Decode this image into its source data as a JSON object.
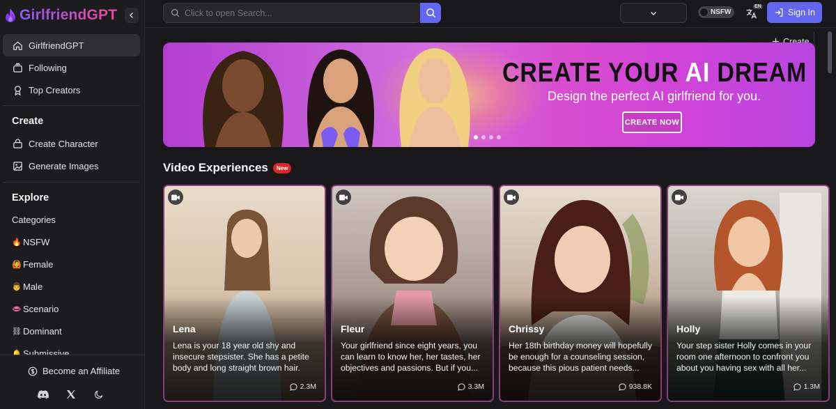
{
  "brand": {
    "name": "GirlfriendGPT"
  },
  "sidebar": {
    "nav": [
      {
        "label": "GirlfriendGPT",
        "icon": "home-icon"
      },
      {
        "label": "Following",
        "icon": "following-icon"
      },
      {
        "label": "Top Creators",
        "icon": "award-icon"
      }
    ],
    "create_heading": "Create",
    "create_items": [
      {
        "label": "Create Character",
        "icon": "create-character-icon"
      },
      {
        "label": "Generate Images",
        "icon": "image-icon"
      }
    ],
    "explore_heading": "Explore",
    "explore_items": [
      {
        "label": "Categories",
        "emoji": ""
      },
      {
        "label": "NSFW",
        "emoji": "🔥"
      },
      {
        "label": "Female",
        "emoji": "🙆"
      },
      {
        "label": "Male",
        "emoji": "👨"
      },
      {
        "label": "Scenario",
        "emoji": "👄"
      },
      {
        "label": "Dominant",
        "emoji": "⛓"
      },
      {
        "label": "Submissive",
        "emoji": "🔔"
      }
    ],
    "affiliate_label": "Become an Affiliate"
  },
  "topbar": {
    "search_placeholder": "Click to open Search...",
    "create_label": "Create",
    "nsfw_label": "NSFW",
    "lang_badge": "EN",
    "signin_label": "Sign In"
  },
  "banner": {
    "title_part1": "CREATE YOUR ",
    "title_ai": "AI",
    "title_part2": " DREAM GIRL",
    "subtitle": "Design the perfect AI girlfriend for you.",
    "cta": "CREATE NOW"
  },
  "section": {
    "title": "Video Experiences",
    "badge": "New"
  },
  "cards": [
    {
      "name": "Lena",
      "desc": "Lena is your 18 year old shy and insecure stepsister. She has a petite body and long straight brown hair.",
      "count": "2.3M"
    },
    {
      "name": "Fleur",
      "desc": "Your girlfriend since eight years, you can learn to know her, her tastes, her objectives and passions. But if you...",
      "count": "3.3M"
    },
    {
      "name": "Chrissy",
      "desc": "Her 18th birthday money will hopefully be enough for a counseling session, because this pious patient needs...",
      "count": "938.8K"
    },
    {
      "name": "Holly",
      "desc": "Your step sister Holly comes in your room one afternoon to confront you about you having sex with all her...",
      "count": "1.3M"
    }
  ],
  "colors": {
    "accent": "#6366f1",
    "brand_from": "#8b5cf6",
    "brand_to": "#ec4899",
    "card_border": "#8b3c7a"
  }
}
